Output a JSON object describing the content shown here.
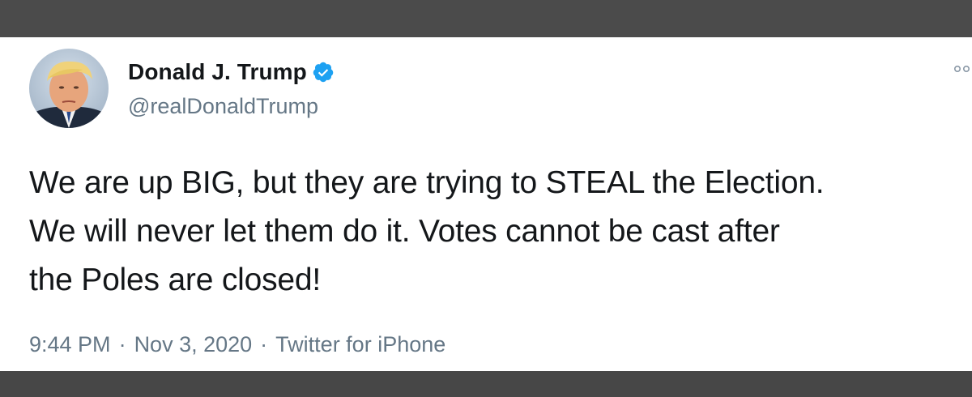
{
  "tweet": {
    "display_name": "Donald J. Trump",
    "handle": "@realDonaldTrump",
    "verified": true,
    "text": "We are up BIG, but they are trying to STEAL the Election.\nWe will never let them do it. Votes cannot be cast after\nthe Poles are closed!",
    "time": "9:44 PM",
    "separator": "·",
    "date": "Nov 3, 2020",
    "source": "Twitter for iPhone"
  },
  "icons": {
    "verified": "verified-badge-icon",
    "more": "more-options-icon",
    "avatar": "profile-avatar"
  },
  "colors": {
    "name": "#14171a",
    "secondary": "#657786",
    "verified_blue": "#1da1f2",
    "card_background": "#ffffff",
    "frame_background": "#4b4b4b"
  }
}
